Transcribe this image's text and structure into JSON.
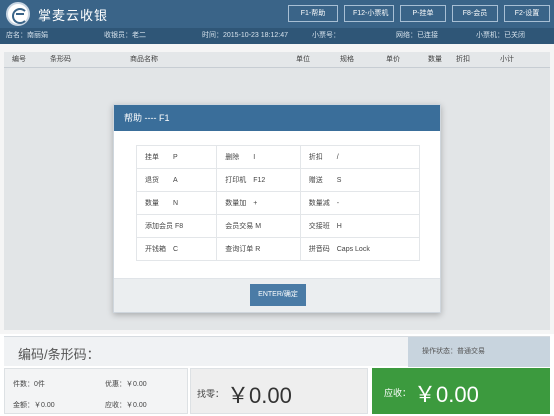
{
  "header": {
    "app_title": "掌麦云收银",
    "buttons": [
      {
        "label": "F1-帮助",
        "icon": "help"
      },
      {
        "label": "F12-小票机",
        "icon": "printer"
      },
      {
        "label": "P-挂单",
        "icon": "hold"
      },
      {
        "label": "F8-会员",
        "icon": "member"
      },
      {
        "label": "F2-设置",
        "icon": "settings"
      }
    ]
  },
  "infobar": {
    "store": "店名：南丽娟",
    "cashier": "收银员：老二",
    "time": "时间：2015-10-23 18:12:47",
    "ticket_no": "小票号：",
    "network": "网络：已连接",
    "printer": "小票机：已关闭"
  },
  "table": {
    "columns": [
      "编号",
      "条形码",
      "商品名称",
      "单位",
      "规格",
      "单价",
      "数量",
      "折扣",
      "小计"
    ]
  },
  "dialog": {
    "title": "帮助 ---- F1",
    "shortcuts": [
      [
        {
          "k": "挂单",
          "v": "P"
        },
        {
          "k": "删除",
          "v": "I"
        },
        {
          "k": "折扣",
          "v": "/"
        }
      ],
      [
        {
          "k": "退货",
          "v": "A"
        },
        {
          "k": "打印机",
          "v": "F12"
        },
        {
          "k": "赠送",
          "v": "S"
        }
      ],
      [
        {
          "k": "数量",
          "v": "N"
        },
        {
          "k": "数量加",
          "v": "+"
        },
        {
          "k": "数量减",
          "v": "-"
        }
      ],
      [
        {
          "k": "添加会员",
          "v": "F8"
        },
        {
          "k": "会员交易",
          "v": "M"
        },
        {
          "k": "交接班",
          "v": "H"
        }
      ],
      [
        {
          "k": "开钱箱",
          "v": "C"
        },
        {
          "k": "查询订单",
          "v": "R"
        },
        {
          "k": "拼音码",
          "v": "Caps Lock"
        }
      ]
    ],
    "confirm_label": "ENTER/确定"
  },
  "code_bar": {
    "label": "编码/条形码：",
    "input_value": "",
    "op_status": "操作状态：普通交易"
  },
  "bottom": {
    "count": "件数：0件",
    "discount": "优惠：￥0.00",
    "total": "金额：￥0.00",
    "receivable_small": "应收：￥0.00",
    "change_label": "找零：",
    "change_value": "￥0.00",
    "due_label": "应收：",
    "due_value": "￥0.00"
  },
  "colors": {
    "header_bg": "#3a6488",
    "dialog_title_bg": "#3a6e9a",
    "due_bg": "#3c9a3e"
  }
}
